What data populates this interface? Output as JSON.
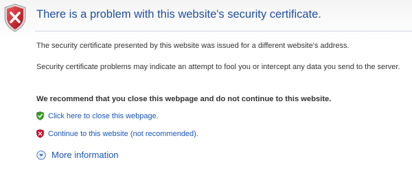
{
  "header": {
    "title": "There is a problem with this website's security certificate."
  },
  "body": {
    "paragraph_1": "The security certificate presented by this website was issued for a different website's address.",
    "paragraph_2": "Security certificate problems may indicate an attempt to fool you or intercept any data you send to the server.",
    "recommendation": "We recommend that you close this webpage and do not continue to this website."
  },
  "actions": {
    "close_link": "Click here to close this webpage.",
    "continue_link": "Continue to this website (not recommended).",
    "more_info": "More information"
  },
  "icons": {
    "header_icon": "shield-error-icon",
    "close_icon": "shield-green-check-icon",
    "continue_icon": "shield-red-x-icon",
    "more_icon": "chevron-down-circle-icon"
  },
  "colors": {
    "title": "#1f4e9e",
    "link": "#1a55b7",
    "error_red": "#c8102e",
    "ok_green": "#3a9a2b"
  }
}
